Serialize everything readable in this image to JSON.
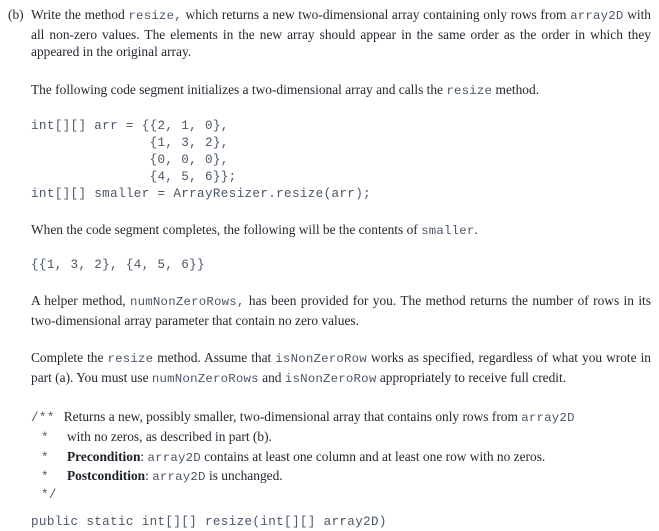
{
  "document": {
    "part_label": "(b)",
    "paragraphs": {
      "intro_1": "Write the method ",
      "intro_1_code": "resize,",
      "intro_1b": " which returns a new two-dimensional array containing only rows from ",
      "intro_1_code2": "array2D",
      "intro_1c": " with all non-zero values. The elements in the new array should appear in the same order as the order in which they appeared in the original array.",
      "intro_2a": "The following code segment initializes a two-dimensional array and calls the ",
      "intro_2_code": "resize",
      "intro_2b": " method.",
      "result_a": "When the code segment completes, the following will be the contents of ",
      "result_code": "smaller",
      "result_b": ".",
      "helper_a": "A helper method, ",
      "helper_code": "numNonZeroRows,",
      "helper_b": " has been provided for you. The method returns the number of rows in its two-dimensional array parameter that contain no zero values.",
      "complete_a": "Complete the ",
      "complete_code1": "resize",
      "complete_b": " method. Assume that ",
      "complete_code2": "isNonZeroRow",
      "complete_c": " works as specified, regardless of what you wrote in part (a). You must use ",
      "complete_code3": "numNonZeroRows",
      "complete_d": " and ",
      "complete_code4": "isNonZeroRow",
      "complete_e": " appropriately to receive full credit."
    },
    "code_segment": {
      "lines": [
        "int[][] arr = {{2, 1, 0},",
        "               {1, 3, 2},",
        "               {0, 0, 0},",
        "               {4, 5, 6}};",
        "int[][] smaller = ArrayResizer.resize(arr);"
      ]
    },
    "expected_output": "{{1, 3, 2}, {4, 5, 6}}",
    "javadoc": {
      "open_token": "/**",
      "star_token": "*",
      "close_token": "*/",
      "line1_text": "Returns a new, possibly smaller, two-dimensional array that contains only rows from ",
      "line1_code": "array2D",
      "line2_text": "with no zeros, as described in part (b).",
      "precondition_label": "Precondition",
      "precondition_sep": ": ",
      "precondition_code": "array2D",
      "precondition_text": " contains at least one column and at least one row with no zeros.",
      "postcondition_label": "Postcondition",
      "postcondition_sep": ": ",
      "postcondition_code": "array2D",
      "postcondition_text": " is unchanged.",
      "signature": "public static int[][] resize(int[][] array2D)"
    }
  },
  "colors": {
    "page_background": "#ffffff",
    "body_text": "#24282f",
    "code_text": "#4a5668"
  }
}
